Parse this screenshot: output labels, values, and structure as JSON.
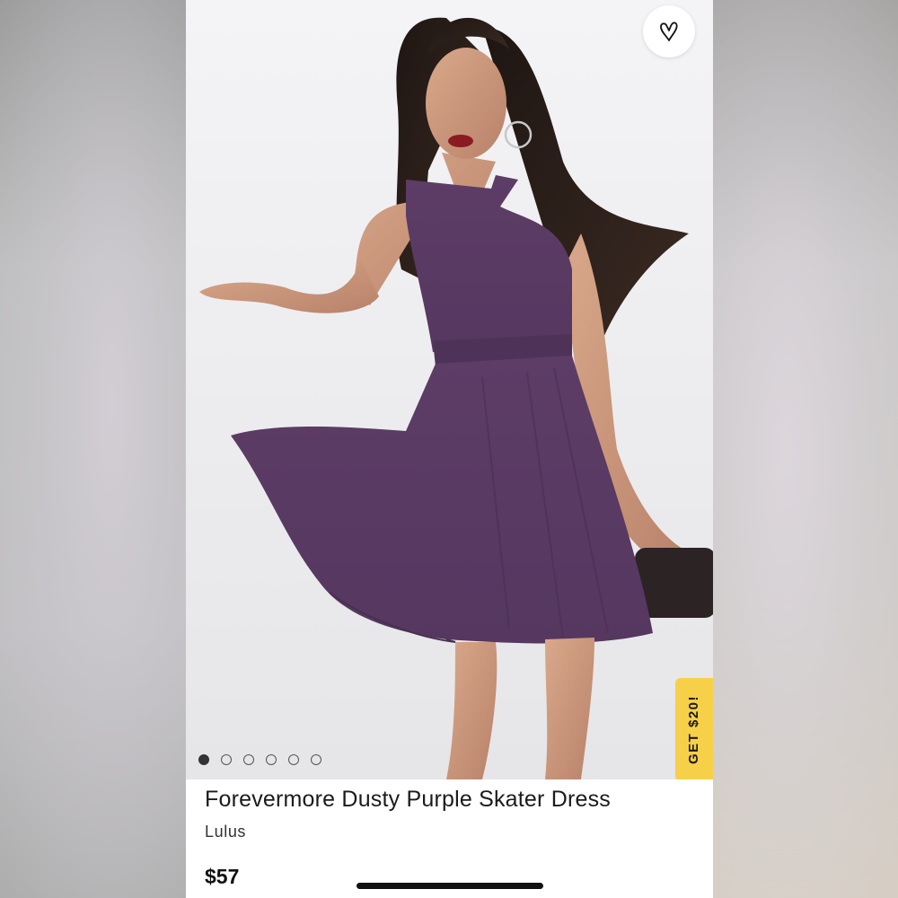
{
  "product": {
    "title": "Forevermore Dusty Purple Skater Dress",
    "brand": "Lulus",
    "price": "$57"
  },
  "gallery": {
    "image_count": 6,
    "active_index": 0,
    "image_subject": "model wearing dusty purple halter skater dress holding a clutch"
  },
  "favorite": {
    "icon": "heart-outline-icon"
  },
  "promo": {
    "label": "GET $20!"
  },
  "colors": {
    "promo_background": "#f7d04a",
    "dress_purple": "#5a3a63",
    "text_primary": "#1b1b1b"
  }
}
